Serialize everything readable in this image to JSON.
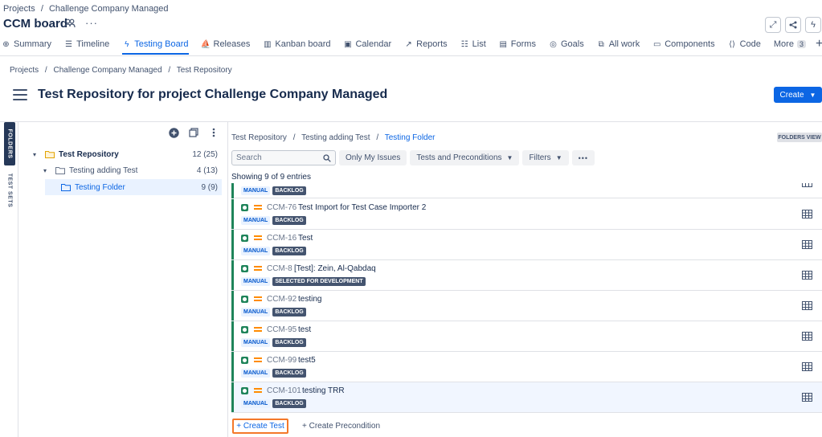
{
  "top_breadcrumb": [
    "Projects",
    "/",
    "Challenge Company Managed"
  ],
  "board_title": "CCM board",
  "top_right_icons": [
    "expand-icon",
    "share-icon",
    "lightning-icon"
  ],
  "tabs": [
    {
      "label": "Summary",
      "icon": "globe-icon"
    },
    {
      "label": "Timeline",
      "icon": "timeline-icon"
    },
    {
      "label": "Testing Board",
      "icon": "lightning-icon",
      "active": true
    },
    {
      "label": "Releases",
      "icon": "ship-icon"
    },
    {
      "label": "Kanban board",
      "icon": "board-icon"
    },
    {
      "label": "Calendar",
      "icon": "calendar-icon"
    },
    {
      "label": "Reports",
      "icon": "chart-icon"
    },
    {
      "label": "List",
      "icon": "list-icon"
    },
    {
      "label": "Forms",
      "icon": "forms-icon"
    },
    {
      "label": "Goals",
      "icon": "target-icon"
    },
    {
      "label": "All work",
      "icon": "stack-icon"
    },
    {
      "label": "Components",
      "icon": "component-icon"
    },
    {
      "label": "Code",
      "icon": "code-icon"
    }
  ],
  "more": {
    "label": "More",
    "count": "3"
  },
  "page_breadcrumb": [
    "Projects",
    "/",
    "Challenge Company Managed",
    "/",
    "Test Repository"
  ],
  "page_title": "Test Repository for project Challenge Company Managed",
  "create_label": "Create",
  "side_tabs": {
    "folders": "FOLDERS",
    "test_sets": "TEST SETS"
  },
  "tree": [
    {
      "label": "Test Repository",
      "count": "12 (25)"
    },
    {
      "label": "Testing adding Test",
      "count": "4 (13)"
    },
    {
      "label": "Testing Folder",
      "count": "9 (9)"
    }
  ],
  "main_breadcrumb": [
    "Test Repository",
    "/",
    "Testing adding Test",
    "/",
    "Testing Folder"
  ],
  "folders_view": "FOLDERS VIEW",
  "search_placeholder": "Search",
  "filters": {
    "only_mine": "Only My Issues",
    "tests_pre": "Tests and Preconditions",
    "filters": "Filters",
    "more": "•••"
  },
  "showing": "Showing 9 of 9 entries",
  "first_row_chips": [
    "MANUAL",
    "BACKLOG"
  ],
  "issues": [
    {
      "key": "CCM-76",
      "summary": "Test Import for Test Case Importer 2",
      "type": "MANUAL",
      "status": "BACKLOG"
    },
    {
      "key": "CCM-16",
      "summary": "Test",
      "type": "MANUAL",
      "status": "BACKLOG"
    },
    {
      "key": "CCM-8",
      "summary": "[Test]: Zein, Al-Qabdaq",
      "type": "MANUAL",
      "status": "SELECTED FOR DEVELOPMENT"
    },
    {
      "key": "CCM-92",
      "summary": "testing",
      "type": "MANUAL",
      "status": "BACKLOG"
    },
    {
      "key": "CCM-95",
      "summary": "test",
      "type": "MANUAL",
      "status": "BACKLOG"
    },
    {
      "key": "CCM-99",
      "summary": "test5",
      "type": "MANUAL",
      "status": "BACKLOG"
    },
    {
      "key": "CCM-101",
      "summary": "testing TRR",
      "type": "MANUAL",
      "status": "BACKLOG"
    }
  ],
  "create_test": "+ Create Test",
  "create_precondition": "+ Create Precondition",
  "colors": {
    "accent": "#0c66e4",
    "test_green": "#1f845a",
    "priority_orange": "#ff8b00",
    "highlight_border": "#f4782a"
  }
}
